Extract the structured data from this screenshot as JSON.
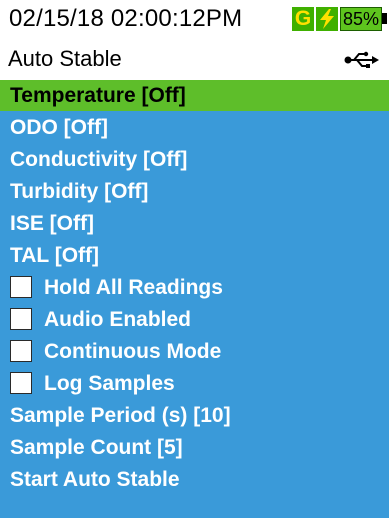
{
  "status_bar": {
    "datetime": "02/15/18 02:00:12PM",
    "gps_badge": "G",
    "power_icon": "lightning-bolt-icon",
    "battery_percent": "85%"
  },
  "header": {
    "title": "Auto Stable",
    "usb_icon": "usb-icon"
  },
  "menu": {
    "items": [
      {
        "label": "Temperature [Off]",
        "selected": true
      },
      {
        "label": "ODO [Off]"
      },
      {
        "label": "Conductivity [Off]"
      },
      {
        "label": "Turbidity [Off]"
      },
      {
        "label": "ISE [Off]"
      },
      {
        "label": "TAL [Off]"
      },
      {
        "label": "Hold All Readings",
        "checkbox": true,
        "checked": false
      },
      {
        "label": "Audio Enabled",
        "checkbox": true,
        "checked": false
      },
      {
        "label": "Continuous Mode",
        "checkbox": true,
        "checked": false
      },
      {
        "label": "Log Samples",
        "checkbox": true,
        "checked": false
      },
      {
        "label": "Sample Period (s) [10]"
      },
      {
        "label": "Sample Count [5]"
      },
      {
        "label": "Start Auto Stable"
      }
    ]
  },
  "colors": {
    "menu_background": "#3a9ad9",
    "selected_background": "#5ebe2a",
    "badge_green": "#3fb000",
    "bolt_yellow": "#ffe000"
  }
}
